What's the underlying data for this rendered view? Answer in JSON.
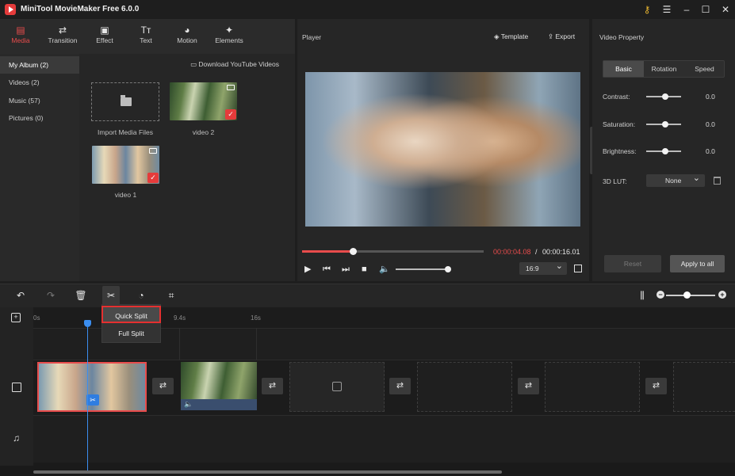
{
  "app": {
    "title": "MiniTool MovieMaker Free 6.0.0",
    "window_controls": [
      "key-icon",
      "menu-icon",
      "minimize-icon",
      "maximize-icon",
      "close-icon"
    ]
  },
  "toolbar": {
    "tabs": [
      {
        "label": "Media",
        "icon": "media-icon",
        "active": true
      },
      {
        "label": "Transition",
        "icon": "transition-icon"
      },
      {
        "label": "Effect",
        "icon": "effect-icon"
      },
      {
        "label": "Text",
        "icon": "text-icon"
      },
      {
        "label": "Motion",
        "icon": "motion-icon"
      },
      {
        "label": "Elements",
        "icon": "elements-icon"
      }
    ]
  },
  "album": {
    "items": [
      {
        "label": "My Album (2)",
        "active": true
      },
      {
        "label": "Videos (2)"
      },
      {
        "label": "Music (57)"
      },
      {
        "label": "Pictures (0)"
      }
    ],
    "youtube_label": "Download YouTube Videos",
    "import_label": "Import Media Files",
    "media": [
      {
        "label": "video 2",
        "checked": true
      },
      {
        "label": "video 1",
        "checked": true
      }
    ]
  },
  "player": {
    "title": "Player",
    "template_label": "Template",
    "export_label": "Export",
    "time_current": "00:00:04.08",
    "time_separator": "/",
    "time_total": "00:00:16.01",
    "progress_fraction": 0.255,
    "volume_fraction": 0.95,
    "aspect_ratio": "16:9"
  },
  "property": {
    "title": "Video Property",
    "tabs": [
      "Basic",
      "Rotation",
      "Speed"
    ],
    "active_tab": "Basic",
    "rows": [
      {
        "label": "Contrast:",
        "value": "0.0"
      },
      {
        "label": "Saturation:",
        "value": "0.0"
      },
      {
        "label": "Brightness:",
        "value": "0.0"
      }
    ],
    "lut_label": "3D LUT:",
    "lut_value": "None",
    "reset_label": "Reset",
    "apply_label": "Apply to all"
  },
  "timeline": {
    "ticks": [
      "0s",
      "9.4s",
      "16s"
    ],
    "split_menu": [
      "Quick Split",
      "Full Split"
    ],
    "colors": {
      "accent": "#e84c4c",
      "playhead": "#3b8ef0",
      "highlight": "#e53030"
    }
  }
}
